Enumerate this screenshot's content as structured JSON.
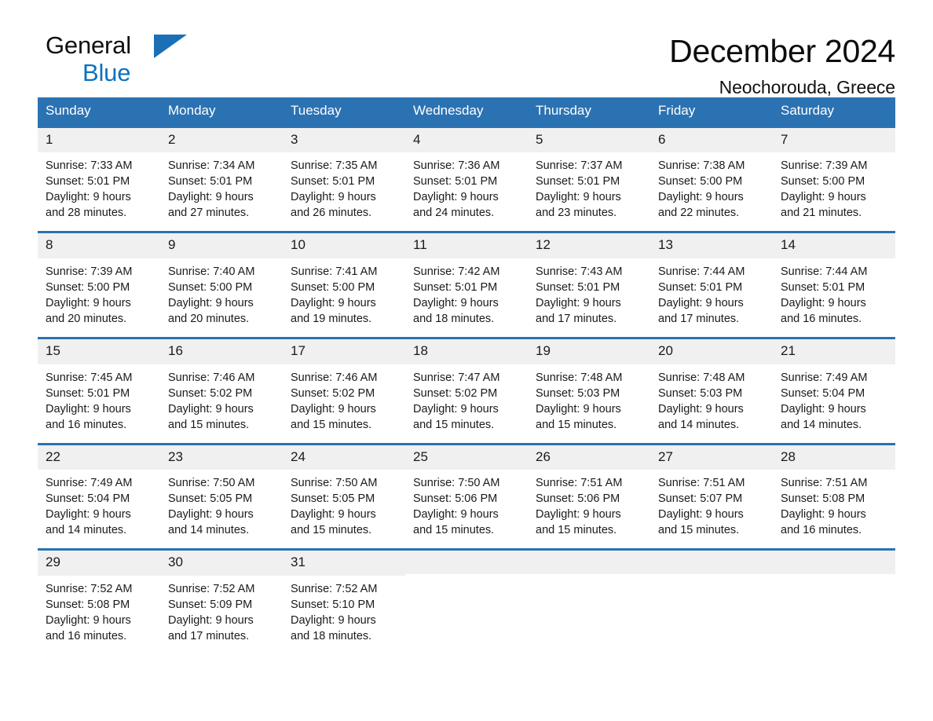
{
  "brand": {
    "name_top": "General",
    "name_bottom": "Blue",
    "triangle_color": "#1b6fb5",
    "blue_text_color": "#0c72c0"
  },
  "header": {
    "title": "December 2024",
    "subtitle": "Neochorouda, Greece"
  },
  "theme": {
    "header_blue": "#2b72b3",
    "daynum_band": "#f0f0f0",
    "page_background": "#ffffff",
    "text_color": "#1a1a1a"
  },
  "weekday_headers": [
    "Sunday",
    "Monday",
    "Tuesday",
    "Wednesday",
    "Thursday",
    "Friday",
    "Saturday"
  ],
  "weeks": [
    [
      {
        "day": "1",
        "sunrise": "Sunrise: 7:33 AM",
        "sunset": "Sunset: 5:01 PM",
        "daylight_line1": "Daylight: 9 hours",
        "daylight_line2": "and 28 minutes."
      },
      {
        "day": "2",
        "sunrise": "Sunrise: 7:34 AM",
        "sunset": "Sunset: 5:01 PM",
        "daylight_line1": "Daylight: 9 hours",
        "daylight_line2": "and 27 minutes."
      },
      {
        "day": "3",
        "sunrise": "Sunrise: 7:35 AM",
        "sunset": "Sunset: 5:01 PM",
        "daylight_line1": "Daylight: 9 hours",
        "daylight_line2": "and 26 minutes."
      },
      {
        "day": "4",
        "sunrise": "Sunrise: 7:36 AM",
        "sunset": "Sunset: 5:01 PM",
        "daylight_line1": "Daylight: 9 hours",
        "daylight_line2": "and 24 minutes."
      },
      {
        "day": "5",
        "sunrise": "Sunrise: 7:37 AM",
        "sunset": "Sunset: 5:01 PM",
        "daylight_line1": "Daylight: 9 hours",
        "daylight_line2": "and 23 minutes."
      },
      {
        "day": "6",
        "sunrise": "Sunrise: 7:38 AM",
        "sunset": "Sunset: 5:00 PM",
        "daylight_line1": "Daylight: 9 hours",
        "daylight_line2": "and 22 minutes."
      },
      {
        "day": "7",
        "sunrise": "Sunrise: 7:39 AM",
        "sunset": "Sunset: 5:00 PM",
        "daylight_line1": "Daylight: 9 hours",
        "daylight_line2": "and 21 minutes."
      }
    ],
    [
      {
        "day": "8",
        "sunrise": "Sunrise: 7:39 AM",
        "sunset": "Sunset: 5:00 PM",
        "daylight_line1": "Daylight: 9 hours",
        "daylight_line2": "and 20 minutes."
      },
      {
        "day": "9",
        "sunrise": "Sunrise: 7:40 AM",
        "sunset": "Sunset: 5:00 PM",
        "daylight_line1": "Daylight: 9 hours",
        "daylight_line2": "and 20 minutes."
      },
      {
        "day": "10",
        "sunrise": "Sunrise: 7:41 AM",
        "sunset": "Sunset: 5:00 PM",
        "daylight_line1": "Daylight: 9 hours",
        "daylight_line2": "and 19 minutes."
      },
      {
        "day": "11",
        "sunrise": "Sunrise: 7:42 AM",
        "sunset": "Sunset: 5:01 PM",
        "daylight_line1": "Daylight: 9 hours",
        "daylight_line2": "and 18 minutes."
      },
      {
        "day": "12",
        "sunrise": "Sunrise: 7:43 AM",
        "sunset": "Sunset: 5:01 PM",
        "daylight_line1": "Daylight: 9 hours",
        "daylight_line2": "and 17 minutes."
      },
      {
        "day": "13",
        "sunrise": "Sunrise: 7:44 AM",
        "sunset": "Sunset: 5:01 PM",
        "daylight_line1": "Daylight: 9 hours",
        "daylight_line2": "and 17 minutes."
      },
      {
        "day": "14",
        "sunrise": "Sunrise: 7:44 AM",
        "sunset": "Sunset: 5:01 PM",
        "daylight_line1": "Daylight: 9 hours",
        "daylight_line2": "and 16 minutes."
      }
    ],
    [
      {
        "day": "15",
        "sunrise": "Sunrise: 7:45 AM",
        "sunset": "Sunset: 5:01 PM",
        "daylight_line1": "Daylight: 9 hours",
        "daylight_line2": "and 16 minutes."
      },
      {
        "day": "16",
        "sunrise": "Sunrise: 7:46 AM",
        "sunset": "Sunset: 5:02 PM",
        "daylight_line1": "Daylight: 9 hours",
        "daylight_line2": "and 15 minutes."
      },
      {
        "day": "17",
        "sunrise": "Sunrise: 7:46 AM",
        "sunset": "Sunset: 5:02 PM",
        "daylight_line1": "Daylight: 9 hours",
        "daylight_line2": "and 15 minutes."
      },
      {
        "day": "18",
        "sunrise": "Sunrise: 7:47 AM",
        "sunset": "Sunset: 5:02 PM",
        "daylight_line1": "Daylight: 9 hours",
        "daylight_line2": "and 15 minutes."
      },
      {
        "day": "19",
        "sunrise": "Sunrise: 7:48 AM",
        "sunset": "Sunset: 5:03 PM",
        "daylight_line1": "Daylight: 9 hours",
        "daylight_line2": "and 15 minutes."
      },
      {
        "day": "20",
        "sunrise": "Sunrise: 7:48 AM",
        "sunset": "Sunset: 5:03 PM",
        "daylight_line1": "Daylight: 9 hours",
        "daylight_line2": "and 14 minutes."
      },
      {
        "day": "21",
        "sunrise": "Sunrise: 7:49 AM",
        "sunset": "Sunset: 5:04 PM",
        "daylight_line1": "Daylight: 9 hours",
        "daylight_line2": "and 14 minutes."
      }
    ],
    [
      {
        "day": "22",
        "sunrise": "Sunrise: 7:49 AM",
        "sunset": "Sunset: 5:04 PM",
        "daylight_line1": "Daylight: 9 hours",
        "daylight_line2": "and 14 minutes."
      },
      {
        "day": "23",
        "sunrise": "Sunrise: 7:50 AM",
        "sunset": "Sunset: 5:05 PM",
        "daylight_line1": "Daylight: 9 hours",
        "daylight_line2": "and 14 minutes."
      },
      {
        "day": "24",
        "sunrise": "Sunrise: 7:50 AM",
        "sunset": "Sunset: 5:05 PM",
        "daylight_line1": "Daylight: 9 hours",
        "daylight_line2": "and 15 minutes."
      },
      {
        "day": "25",
        "sunrise": "Sunrise: 7:50 AM",
        "sunset": "Sunset: 5:06 PM",
        "daylight_line1": "Daylight: 9 hours",
        "daylight_line2": "and 15 minutes."
      },
      {
        "day": "26",
        "sunrise": "Sunrise: 7:51 AM",
        "sunset": "Sunset: 5:06 PM",
        "daylight_line1": "Daylight: 9 hours",
        "daylight_line2": "and 15 minutes."
      },
      {
        "day": "27",
        "sunrise": "Sunrise: 7:51 AM",
        "sunset": "Sunset: 5:07 PM",
        "daylight_line1": "Daylight: 9 hours",
        "daylight_line2": "and 15 minutes."
      },
      {
        "day": "28",
        "sunrise": "Sunrise: 7:51 AM",
        "sunset": "Sunset: 5:08 PM",
        "daylight_line1": "Daylight: 9 hours",
        "daylight_line2": "and 16 minutes."
      }
    ],
    [
      {
        "day": "29",
        "sunrise": "Sunrise: 7:52 AM",
        "sunset": "Sunset: 5:08 PM",
        "daylight_line1": "Daylight: 9 hours",
        "daylight_line2": "and 16 minutes."
      },
      {
        "day": "30",
        "sunrise": "Sunrise: 7:52 AM",
        "sunset": "Sunset: 5:09 PM",
        "daylight_line1": "Daylight: 9 hours",
        "daylight_line2": "and 17 minutes."
      },
      {
        "day": "31",
        "sunrise": "Sunrise: 7:52 AM",
        "sunset": "Sunset: 5:10 PM",
        "daylight_line1": "Daylight: 9 hours",
        "daylight_line2": "and 18 minutes."
      },
      {
        "day": "",
        "sunrise": "",
        "sunset": "",
        "daylight_line1": "",
        "daylight_line2": ""
      },
      {
        "day": "",
        "sunrise": "",
        "sunset": "",
        "daylight_line1": "",
        "daylight_line2": ""
      },
      {
        "day": "",
        "sunrise": "",
        "sunset": "",
        "daylight_line1": "",
        "daylight_line2": ""
      },
      {
        "day": "",
        "sunrise": "",
        "sunset": "",
        "daylight_line1": "",
        "daylight_line2": ""
      }
    ]
  ]
}
